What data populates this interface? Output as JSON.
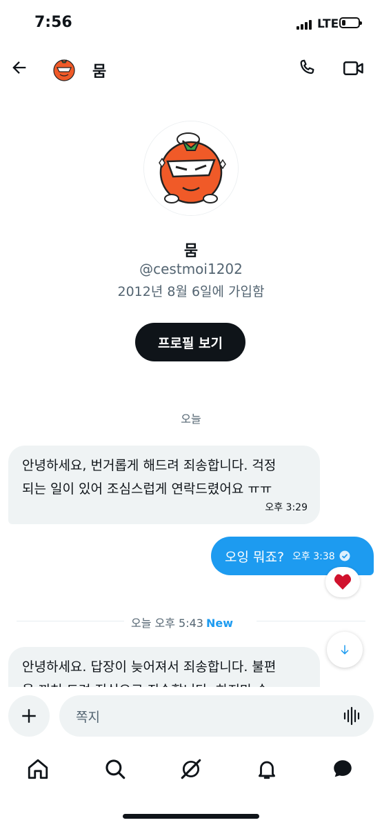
{
  "status_bar": {
    "time": "7:56",
    "network": "LTE"
  },
  "header": {
    "name": "뭄"
  },
  "profile": {
    "name": "뭄",
    "handle": "@cestmoi1202",
    "joined": "2012년 8월 6일에 가입함",
    "view_profile_label": "프로필 보기"
  },
  "conversation": {
    "date_separator": "오늘",
    "messages": [
      {
        "direction": "incoming",
        "lines": [
          "안녕하세요, 번거롭게 해드려 죄송합니다. 걱정",
          "되는 일이 있어 조심스럽게 연락드렸어요 ㅠㅠ"
        ],
        "time": "오후 3:29"
      },
      {
        "direction": "outgoing",
        "text": "오잉 뭐죠?",
        "time": "오후 3:38",
        "reaction": "heart"
      },
      {
        "direction": "incoming",
        "lines": [
          "안녕하세요. 답장이 늦어져서 죄송합니다. 불편",
          "을 끼쳐 드려 진심으로 죄송합니다. 하지만 숭"
        ]
      }
    ],
    "new_separator": {
      "label": "오늘 오후 5:43",
      "badge": "New"
    }
  },
  "composer": {
    "placeholder": "쪽지"
  },
  "tabs": [
    {
      "icon": "home-icon"
    },
    {
      "icon": "search-icon"
    },
    {
      "icon": "grok-icon"
    },
    {
      "icon": "bell-icon"
    },
    {
      "icon": "messages-icon"
    }
  ],
  "colors": {
    "accent": "#1d9bf0",
    "bubble_in": "#eff3f4",
    "text": "#0f1419",
    "secondary": "#536471"
  }
}
